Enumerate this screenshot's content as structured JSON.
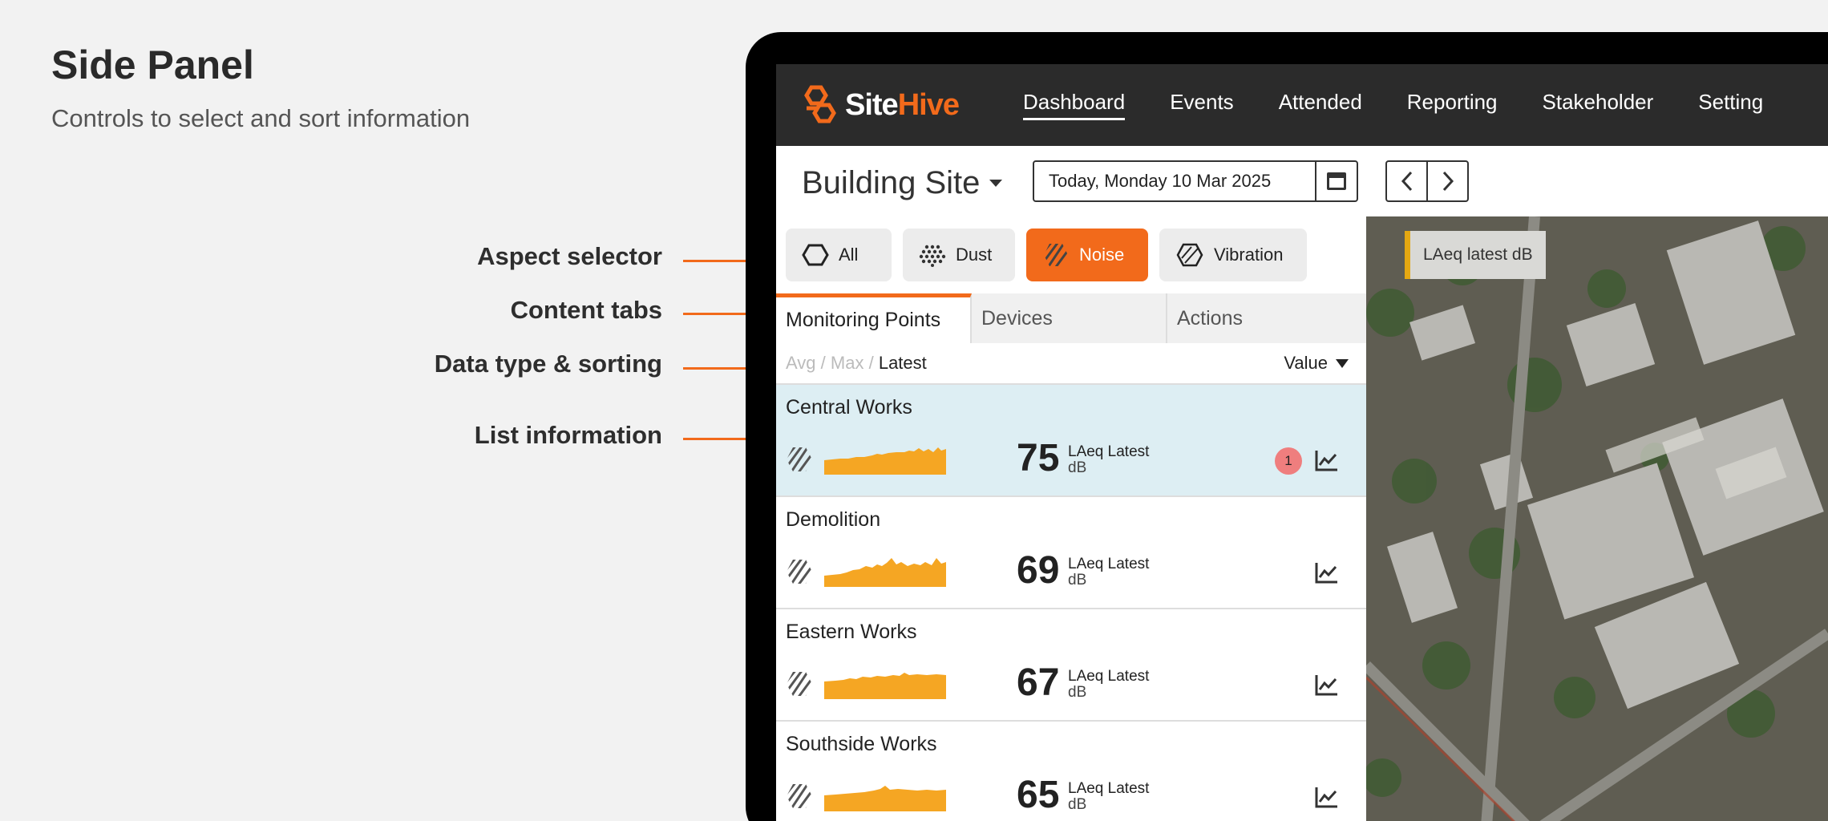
{
  "doc": {
    "title": "Side Panel",
    "subtitle": "Controls to select and sort information"
  },
  "callouts": [
    {
      "label": "Aspect selector"
    },
    {
      "label": "Content tabs"
    },
    {
      "label": "Data type & sorting"
    },
    {
      "label": "List information"
    }
  ],
  "app": {
    "logo_site": "Site",
    "logo_hive": "Hive",
    "nav": [
      {
        "label": "Dashboard",
        "active": true
      },
      {
        "label": "Events"
      },
      {
        "label": "Attended"
      },
      {
        "label": "Reporting"
      },
      {
        "label": "Stakeholder"
      },
      {
        "label": "Setting"
      }
    ],
    "site": "Building Site",
    "date": "Today,  Monday 10 Mar 2025"
  },
  "aspects": [
    {
      "label": "All",
      "icon": "hexagon-icon"
    },
    {
      "label": "Dust",
      "icon": "dust-icon"
    },
    {
      "label": "Noise",
      "icon": "noise-icon",
      "active": true
    },
    {
      "label": "Vibration",
      "icon": "vibration-icon"
    }
  ],
  "tabs": [
    {
      "label": "Monitoring Points",
      "active": true
    },
    {
      "label": "Devices"
    },
    {
      "label": "Actions"
    }
  ],
  "data_type": {
    "avg": "Avg",
    "max": "Max",
    "latest": "Latest",
    "sep": "/",
    "selected": "Latest"
  },
  "sort": {
    "label": "Value"
  },
  "list": [
    {
      "name": "Central Works",
      "value": "75",
      "metric": "LAeq Latest",
      "unit": "dB",
      "alerts": "1",
      "selected": true
    },
    {
      "name": "Demolition",
      "value": "69",
      "metric": "LAeq Latest",
      "unit": "dB"
    },
    {
      "name": "Eastern Works",
      "value": "67",
      "metric": "LAeq Latest",
      "unit": "dB"
    },
    {
      "name": "Southside Works",
      "value": "65",
      "metric": "LAeq Latest",
      "unit": "dB"
    }
  ],
  "map": {
    "legend": "LAeq latest dB"
  },
  "colors": {
    "accent": "#f26a1b",
    "spark": "#f5a623",
    "selected_row": "#ddeef3",
    "alert": "#ef7e7e"
  }
}
